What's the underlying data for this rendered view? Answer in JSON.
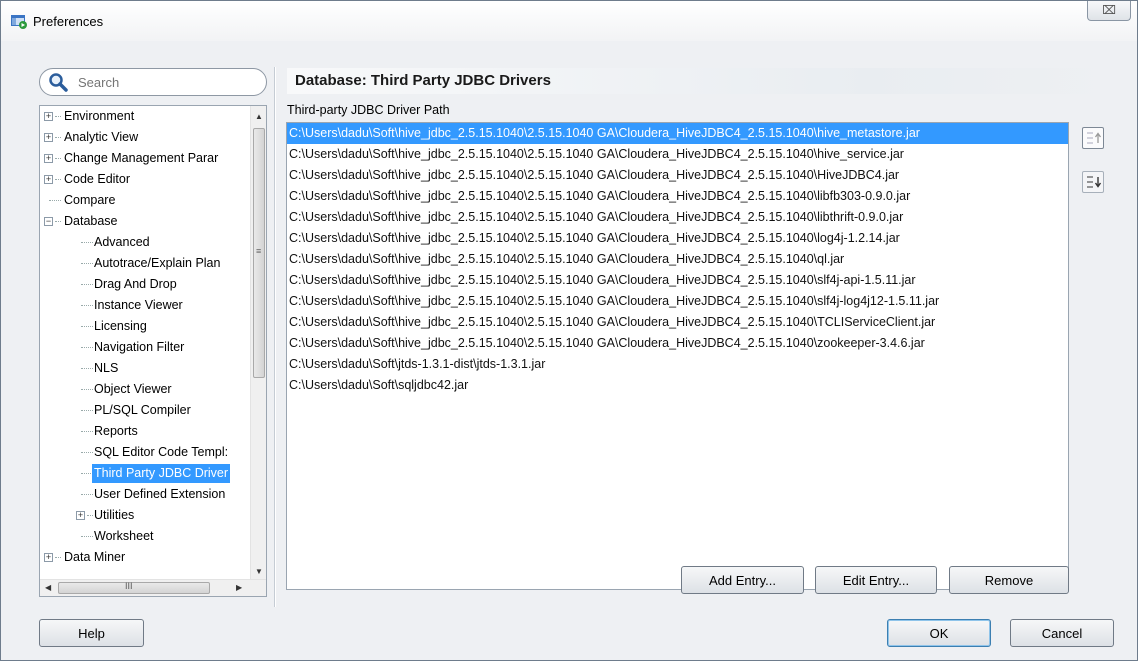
{
  "window": {
    "title": "Preferences",
    "close_label": "⌧"
  },
  "search": {
    "placeholder": "Search"
  },
  "tree": {
    "items": [
      {
        "label": "Environment",
        "level": 0,
        "expander": "+"
      },
      {
        "label": "Analytic View",
        "level": 0,
        "expander": "+"
      },
      {
        "label": "Change Management Parar",
        "level": 0,
        "expander": "+"
      },
      {
        "label": "Code Editor",
        "level": 0,
        "expander": "+"
      },
      {
        "label": "Compare",
        "level": 0,
        "expander": ""
      },
      {
        "label": "Database",
        "level": 0,
        "expander": "−"
      },
      {
        "label": "Advanced",
        "level": 1,
        "expander": ""
      },
      {
        "label": "Autotrace/Explain Plan",
        "level": 1,
        "expander": ""
      },
      {
        "label": "Drag And Drop",
        "level": 1,
        "expander": ""
      },
      {
        "label": "Instance Viewer",
        "level": 1,
        "expander": ""
      },
      {
        "label": "Licensing",
        "level": 1,
        "expander": ""
      },
      {
        "label": "Navigation Filter",
        "level": 1,
        "expander": ""
      },
      {
        "label": "NLS",
        "level": 1,
        "expander": ""
      },
      {
        "label": "Object Viewer",
        "level": 1,
        "expander": ""
      },
      {
        "label": "PL/SQL Compiler",
        "level": 1,
        "expander": ""
      },
      {
        "label": "Reports",
        "level": 1,
        "expander": ""
      },
      {
        "label": "SQL Editor Code Templ:",
        "level": 1,
        "expander": ""
      },
      {
        "label": "Third Party JDBC Driver",
        "level": 1,
        "expander": "",
        "selected": true
      },
      {
        "label": "User Defined Extension",
        "level": 1,
        "expander": ""
      },
      {
        "label": "Utilities",
        "level": 1,
        "expander": "+"
      },
      {
        "label": "Worksheet",
        "level": 1,
        "expander": ""
      },
      {
        "label": "Data Miner",
        "level": 0,
        "expander": "+"
      }
    ],
    "scroll_thumb_label": "III"
  },
  "panel": {
    "title": "Database: Third Party JDBC Drivers",
    "path_label": "Third-party JDBC Driver Path",
    "entries": [
      "C:\\Users\\dadu\\Soft\\hive_jdbc_2.5.15.1040\\2.5.15.1040 GA\\Cloudera_HiveJDBC4_2.5.15.1040\\hive_metastore.jar",
      "C:\\Users\\dadu\\Soft\\hive_jdbc_2.5.15.1040\\2.5.15.1040 GA\\Cloudera_HiveJDBC4_2.5.15.1040\\hive_service.jar",
      "C:\\Users\\dadu\\Soft\\hive_jdbc_2.5.15.1040\\2.5.15.1040 GA\\Cloudera_HiveJDBC4_2.5.15.1040\\HiveJDBC4.jar",
      "C:\\Users\\dadu\\Soft\\hive_jdbc_2.5.15.1040\\2.5.15.1040 GA\\Cloudera_HiveJDBC4_2.5.15.1040\\libfb303-0.9.0.jar",
      "C:\\Users\\dadu\\Soft\\hive_jdbc_2.5.15.1040\\2.5.15.1040 GA\\Cloudera_HiveJDBC4_2.5.15.1040\\libthrift-0.9.0.jar",
      "C:\\Users\\dadu\\Soft\\hive_jdbc_2.5.15.1040\\2.5.15.1040 GA\\Cloudera_HiveJDBC4_2.5.15.1040\\log4j-1.2.14.jar",
      "C:\\Users\\dadu\\Soft\\hive_jdbc_2.5.15.1040\\2.5.15.1040 GA\\Cloudera_HiveJDBC4_2.5.15.1040\\ql.jar",
      "C:\\Users\\dadu\\Soft\\hive_jdbc_2.5.15.1040\\2.5.15.1040 GA\\Cloudera_HiveJDBC4_2.5.15.1040\\slf4j-api-1.5.11.jar",
      "C:\\Users\\dadu\\Soft\\hive_jdbc_2.5.15.1040\\2.5.15.1040 GA\\Cloudera_HiveJDBC4_2.5.15.1040\\slf4j-log4j12-1.5.11.jar",
      "C:\\Users\\dadu\\Soft\\hive_jdbc_2.5.15.1040\\2.5.15.1040 GA\\Cloudera_HiveJDBC4_2.5.15.1040\\TCLIServiceClient.jar",
      "C:\\Users\\dadu\\Soft\\hive_jdbc_2.5.15.1040\\2.5.15.1040 GA\\Cloudera_HiveJDBC4_2.5.15.1040\\zookeeper-3.4.6.jar",
      "C:\\Users\\dadu\\Soft\\jtds-1.3.1-dist\\jtds-1.3.1.jar",
      "C:\\Users\\dadu\\Soft\\sqljdbc42.jar"
    ],
    "selected_index": 0,
    "add_label": "Add Entry...",
    "edit_label": "Edit Entry...",
    "remove_label": "Remove"
  },
  "footer": {
    "help_label": "Help",
    "ok_label": "OK",
    "cancel_label": "Cancel"
  },
  "colors": {
    "selection": "#3399ff",
    "window_bg": "#eef0f3"
  }
}
